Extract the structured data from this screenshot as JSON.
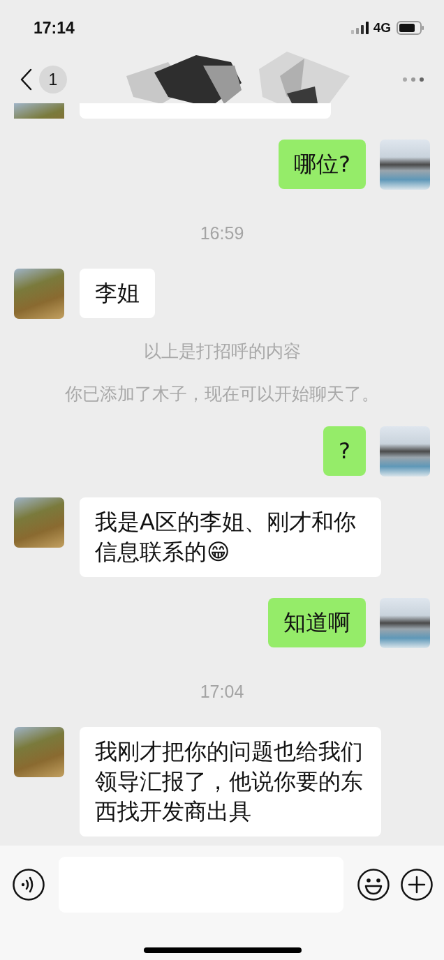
{
  "status_bar": {
    "time": "17:14",
    "network": "4G"
  },
  "header": {
    "unread_count": "1"
  },
  "messages": [
    {
      "kind": "partial"
    },
    {
      "kind": "outgoing",
      "text": "哪位?"
    },
    {
      "kind": "time",
      "text": "16:59"
    },
    {
      "kind": "incoming",
      "text": "李姐"
    },
    {
      "kind": "system",
      "text": "以上是打招呼的内容"
    },
    {
      "kind": "system",
      "text": "你已添加了木子，现在可以开始聊天了。"
    },
    {
      "kind": "outgoing",
      "text": "?"
    },
    {
      "kind": "incoming",
      "text": "我是A区的李姐、刚才和你信息联系的😁"
    },
    {
      "kind": "outgoing",
      "text": "知道啊"
    },
    {
      "kind": "time",
      "text": "17:04"
    },
    {
      "kind": "incoming",
      "text": "我刚才把你的问题也给我们领导汇报了，他说你要的东西找开发商出具"
    }
  ]
}
